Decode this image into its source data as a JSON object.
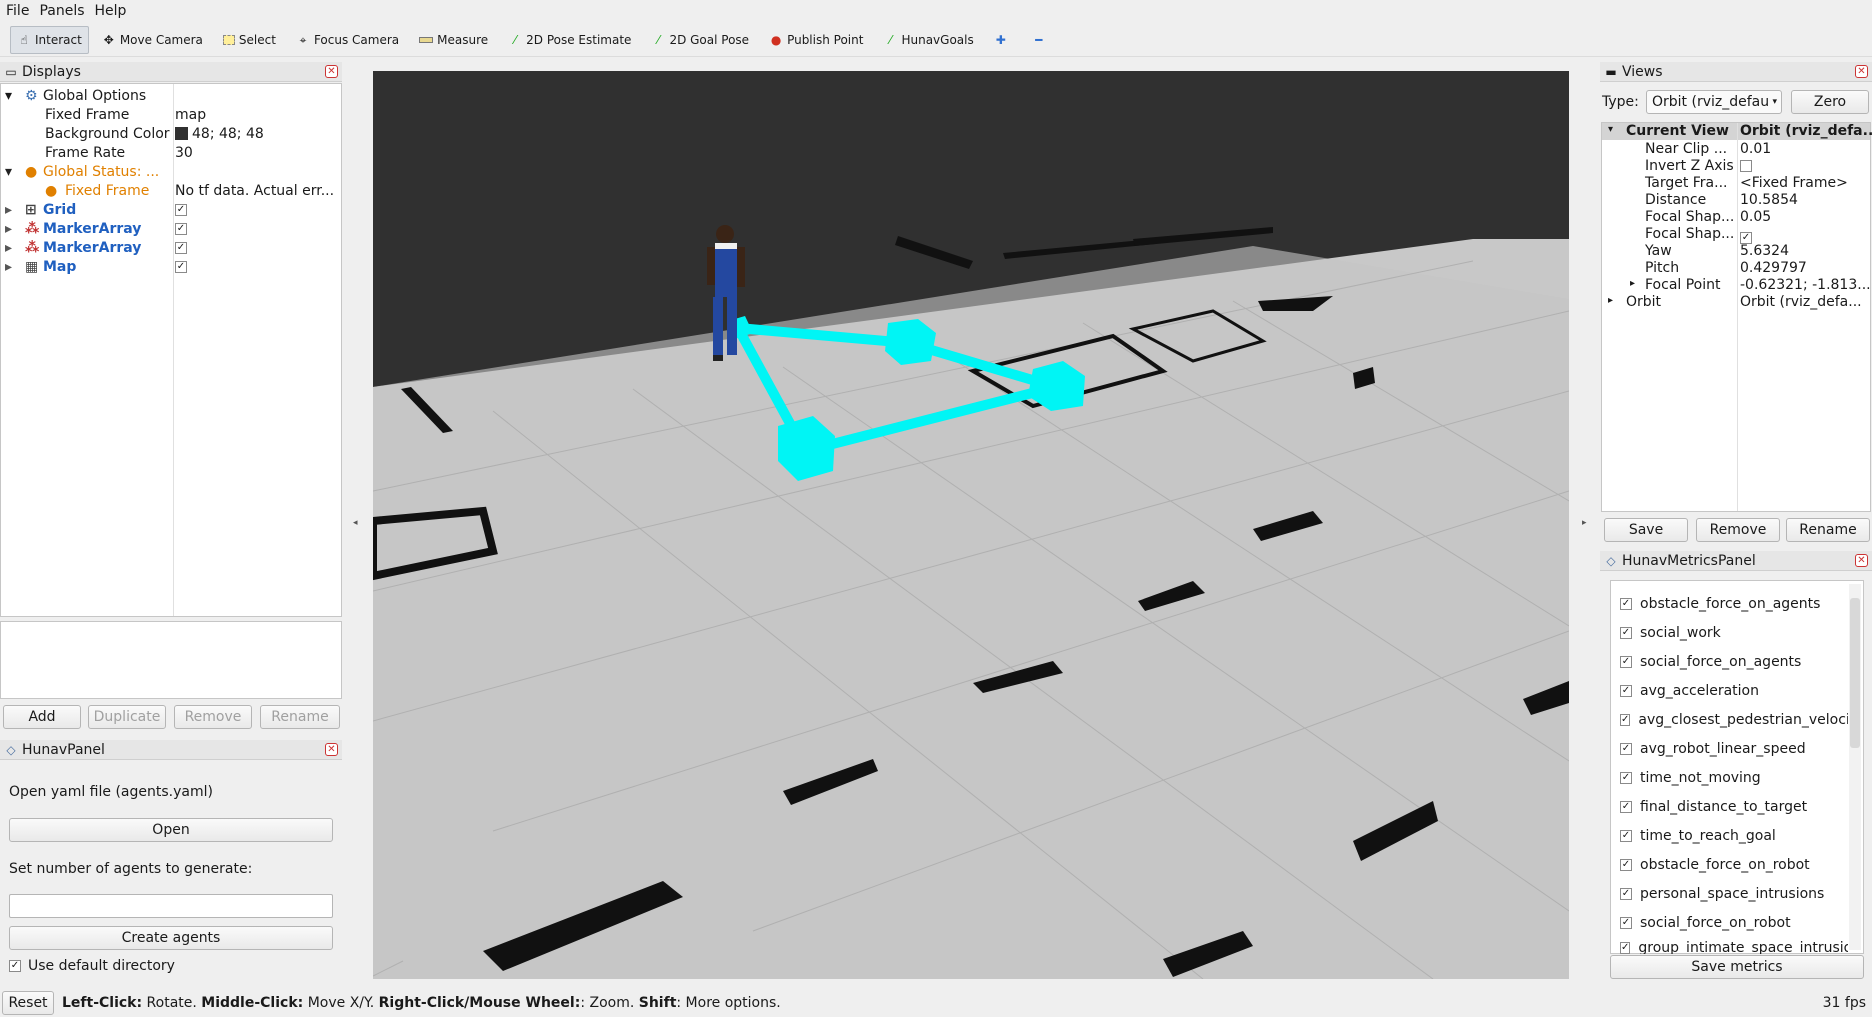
{
  "menu": {
    "file": "File",
    "panels": "Panels",
    "help": "Help"
  },
  "toolbar": {
    "interact": "Interact",
    "move_camera": "Move Camera",
    "select": "Select",
    "focus_camera": "Focus Camera",
    "measure": "Measure",
    "pose_estimate": "2D Pose Estimate",
    "goal_pose": "2D Goal Pose",
    "publish_point": "Publish Point",
    "hunav_goals": "HunavGoals"
  },
  "displays": {
    "title": "Displays",
    "global_options": "Global Options",
    "fixed_frame_label": "Fixed Frame",
    "fixed_frame_value": "map",
    "bg_label": "Background Color",
    "bg_value": "48; 48; 48",
    "bg_color": "#303030",
    "fps_label": "Frame Rate",
    "fps_value": "30",
    "global_status": "Global Status: ...",
    "status_fixed_frame": "Fixed Frame",
    "status_msg": "No tf data.  Actual err...",
    "items": [
      "Grid",
      "MarkerArray",
      "MarkerArray",
      "Map"
    ],
    "buttons": {
      "add": "Add",
      "duplicate": "Duplicate",
      "remove": "Remove",
      "rename": "Rename"
    }
  },
  "hunav_panel": {
    "title": "HunavPanel",
    "open_label": "Open yaml file (agents.yaml)",
    "open_button": "Open",
    "agents_label": "Set number of agents to generate:",
    "agents_value": "",
    "create_button": "Create agents",
    "default_dir": "Use default directory"
  },
  "views": {
    "title": "Views",
    "type_label": "Type:",
    "type_value": "Orbit (rviz_defau",
    "zero": "Zero",
    "col1": "Current View",
    "col2": "Orbit (rviz_defa...",
    "props": [
      {
        "k": "Near Clip ...",
        "v": "0.01"
      },
      {
        "k": "Invert Z Axis",
        "v": ""
      },
      {
        "k": "Target Fra...",
        "v": "<Fixed Frame>"
      },
      {
        "k": "Distance",
        "v": "10.5854"
      },
      {
        "k": "Focal Shap...",
        "v": "0.05"
      },
      {
        "k": "Focal Shap...",
        "v": ""
      },
      {
        "k": "Yaw",
        "v": "5.6324"
      },
      {
        "k": "Pitch",
        "v": "0.429797"
      },
      {
        "k": "Focal Point",
        "v": "-0.62321; -1.813..."
      },
      {
        "k": "Orbit",
        "v": "Orbit (rviz_defa..."
      }
    ],
    "save": "Save",
    "remove": "Remove",
    "rename": "Rename"
  },
  "metrics": {
    "title": "HunavMetricsPanel",
    "items": [
      "obstacle_force_on_agents",
      "social_work",
      "social_force_on_agents",
      "avg_acceleration",
      "avg_closest_pedestrian_velocit",
      "avg_robot_linear_speed",
      "time_not_moving",
      "final_distance_to_target",
      "time_to_reach_goal",
      "obstacle_force_on_robot",
      "personal_space_intrusions",
      "social_force_on_robot",
      "group_intimate_space_intrusio"
    ],
    "save": "Save metrics"
  },
  "status": {
    "reset": "Reset",
    "b1": "Left-Click:",
    "t1": " Rotate. ",
    "b2": "Middle-Click:",
    "t2": " Move X/Y. ",
    "b3": "Right-Click/Mouse Wheel:",
    "t3": ": Zoom. ",
    "b4": "Shift",
    "t4": ": More options.",
    "fps": "31 fps"
  },
  "colors": {
    "marker": "#00f5f5",
    "grid_floor": "#c8c8c8",
    "background": "#303030"
  }
}
